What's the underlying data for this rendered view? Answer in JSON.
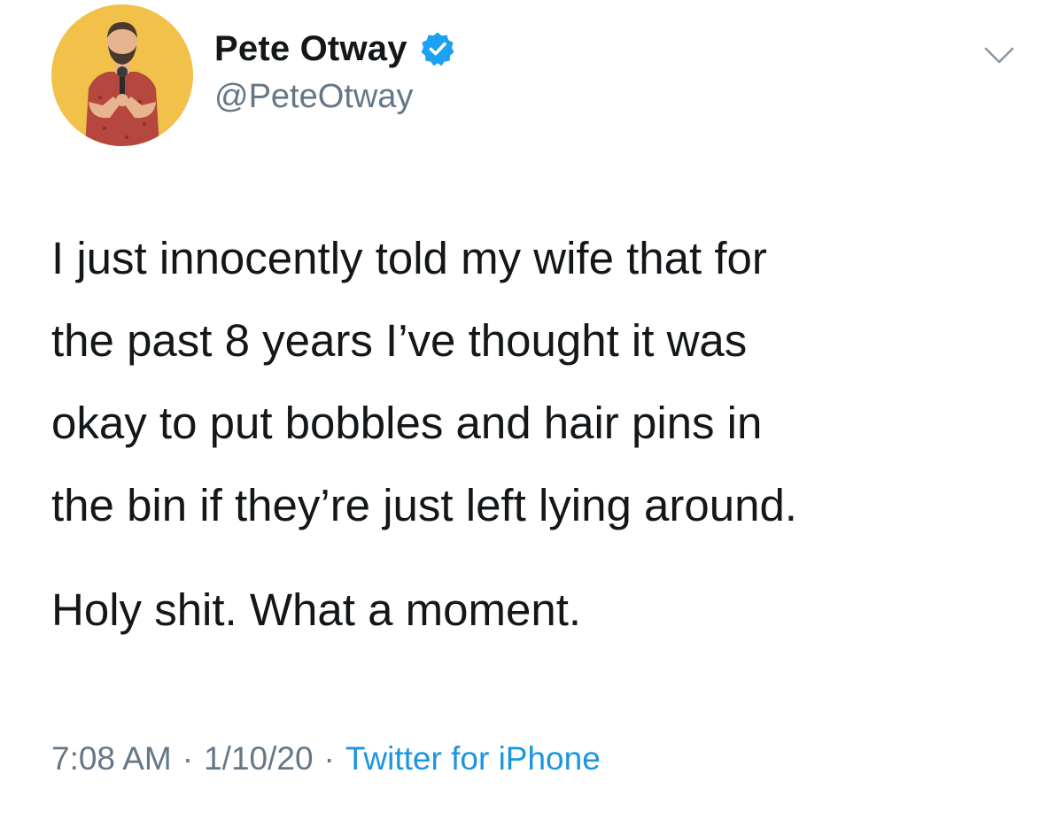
{
  "user": {
    "display_name": "Pete Otway",
    "handle": "@PeteOtway",
    "verified": true,
    "avatar_background": "#f2c14a"
  },
  "tweet": {
    "lines_para1": [
      "I just innocently told my wife that for",
      "the past 8 years I’ve thought it was",
      "okay to put bobbles and hair pins in",
      "the bin if they’re just left lying around."
    ],
    "para2": "Holy shit. What a moment."
  },
  "meta": {
    "time": "7:08 AM",
    "date": "1/10/20",
    "separator": "·",
    "source": "Twitter for iPhone"
  },
  "icons": {
    "verified": "verified-badge-icon",
    "more": "chevron-down-icon"
  },
  "colors": {
    "text_primary": "#14171a",
    "text_secondary": "#657786",
    "link": "#1b95e0",
    "verified_blue": "#1da1f2"
  }
}
